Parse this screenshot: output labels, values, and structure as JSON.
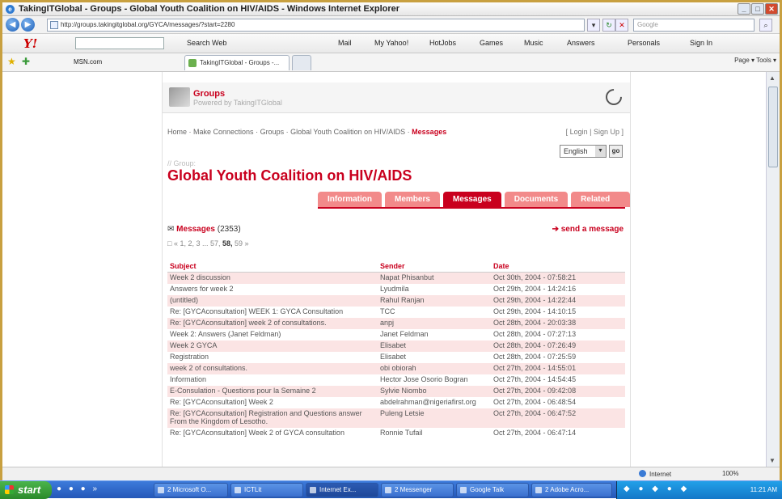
{
  "window": {
    "title": "TakingITGlobal - Groups - Global Youth Coalition on HIV/AIDS - Windows Internet Explorer"
  },
  "address": {
    "url": "http://groups.takingitglobal.org/GYCA/messages/?start=2280",
    "search_placeholder": "Google"
  },
  "yahoo_toolbar": {
    "brand": "Y!",
    "items": [
      "Search Web",
      "Mail",
      "My Yahoo!",
      "HotJobs",
      "Games",
      "Music",
      "Answers",
      "Personals",
      "Sign In"
    ]
  },
  "favorites": {
    "link": "MSN.com",
    "tab_label": "TakingITGlobal - Groups -...",
    "commands": "Page ▾  Tools ▾"
  },
  "site": {
    "header_title": "Groups",
    "header_subtitle": "Powered by TakingITGlobal",
    "breadcrumbs": [
      "Home",
      "Make Connections",
      "Groups",
      "Global Youth Coalition on HIV/AIDS",
      "Messages"
    ],
    "login_signup": "[ Login | Sign Up ]",
    "language": "English",
    "go_label": "go",
    "group_label": "// Group:",
    "group_title": "Global Youth Coalition on HIV/AIDS",
    "tabs": [
      "Information",
      "Members",
      "Messages",
      "Documents",
      "Related Items"
    ],
    "active_tab": "Messages",
    "messages_label": "Messages",
    "messages_count": "(2353)",
    "send_message": "send a message",
    "pager": "« 1, 2, 3 ... 57,",
    "pager_current": "58,",
    "pager_rest": "59 »"
  },
  "table": {
    "columns": [
      "Subject",
      "Sender",
      "Date"
    ],
    "rows": [
      {
        "subject": "Week 2 discussion",
        "sender": "Napat Phisanbut",
        "date": "Oct 30th, 2004 - 07:58:21"
      },
      {
        "subject": "Answers for week 2",
        "sender": "Lyudmila",
        "date": "Oct 29th, 2004 - 14:24:16"
      },
      {
        "subject": "(untitled)",
        "sender": "Rahul Ranjan",
        "date": "Oct 29th, 2004 - 14:22:44"
      },
      {
        "subject": "Re: [GYCAconsultation] WEEK 1: GYCA Consultation",
        "sender": "TCC",
        "date": "Oct 29th, 2004 - 14:10:15"
      },
      {
        "subject": "Re: [GYCAconsultation] week 2 of consultations.",
        "sender": "anpj",
        "date": "Oct 28th, 2004 - 20:03:38"
      },
      {
        "subject": "Week 2: Answers (Janet Feldman)",
        "sender": "Janet Feldman",
        "date": "Oct 28th, 2004 - 07:27:13"
      },
      {
        "subject": "Week 2 GYCA",
        "sender": "Elisabet",
        "date": "Oct 28th, 2004 - 07:26:49"
      },
      {
        "subject": "Registration",
        "sender": "Elisabet",
        "date": "Oct 28th, 2004 - 07:25:59"
      },
      {
        "subject": "week 2 of consultations.",
        "sender": "obi obiorah",
        "date": "Oct 27th, 2004 - 14:55:01"
      },
      {
        "subject": "Information",
        "sender": "Hector Jose Osorio Bogran",
        "date": "Oct 27th, 2004 - 14:54:45"
      },
      {
        "subject": "E-Consulation - Questions pour la Semaine 2",
        "sender": "Sylvie Niombo",
        "date": "Oct 27th, 2004 - 09:42:08"
      },
      {
        "subject": "Re: [GYCAconsultation] Week 2",
        "sender": "abdelrahman@nigeriafirst.org",
        "date": "Oct 27th, 2004 - 06:48:54"
      },
      {
        "subject": "Re: [GYCAconsultation] Registration and Questions answer From the Kingdom of Lesotho.",
        "sender": "Puleng Letsie",
        "date": "Oct 27th, 2004 - 06:47:52"
      },
      {
        "subject": "Re: [GYCAconsultation] Week 2 of GYCA consultation",
        "sender": "Ronnie Tufail",
        "date": "Oct 27th, 2004 - 06:47:14"
      }
    ]
  },
  "statusbar": {
    "zone": "Internet",
    "zoom": "100%"
  },
  "taskbar": {
    "start": "start",
    "buttons": [
      "2 Microsoft O...",
      "ICTLit",
      "Internet Ex...",
      "2 Messenger",
      "Google Talk",
      "2 Adobe Acro..."
    ],
    "active": "Internet Ex...",
    "clock": "11:21 AM"
  }
}
